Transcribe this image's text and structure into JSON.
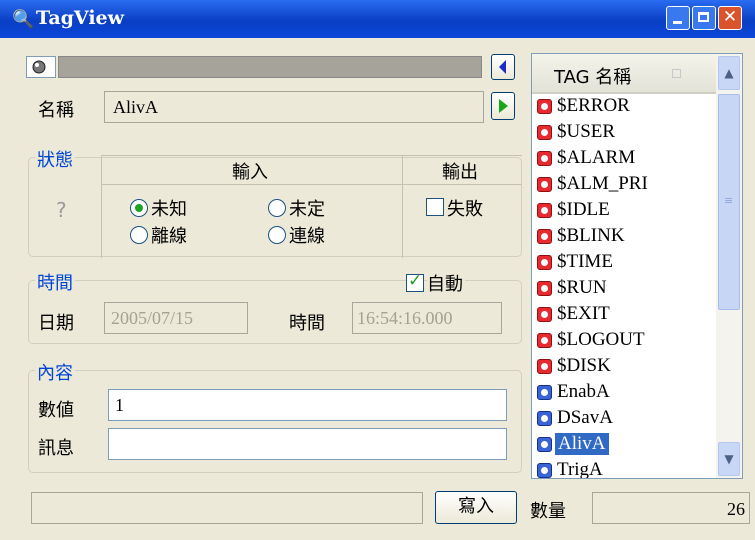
{
  "window": {
    "title": "TagView"
  },
  "top": {
    "name_label": "名稱",
    "name_value": "AlivA"
  },
  "status": {
    "group_label": "狀態",
    "unknown_mark": "?",
    "input_header": "輸入",
    "output_header": "輸出",
    "radios": [
      {
        "label": "未知",
        "selected": true
      },
      {
        "label": "未定",
        "selected": false
      },
      {
        "label": "離線",
        "selected": false
      },
      {
        "label": "連線",
        "selected": false
      }
    ],
    "fail_label": "失敗",
    "fail_checked": false
  },
  "time": {
    "group_label": "時間",
    "auto_label": "自動",
    "auto_checked": true,
    "date_label": "日期",
    "date_value": "2005/07/15",
    "time_label": "時間",
    "time_value": "16:54:16.000"
  },
  "content": {
    "group_label": "內容",
    "value_label": "數値",
    "value": "1",
    "message_label": "訊息",
    "message": ""
  },
  "bottom": {
    "write_button": "寫入",
    "count_label": "數量",
    "count_value": "26"
  },
  "taglist": {
    "header": "TAG 名稱",
    "items": [
      {
        "name": "$ERROR",
        "type": "system"
      },
      {
        "name": "$USER",
        "type": "system"
      },
      {
        "name": "$ALARM",
        "type": "system"
      },
      {
        "name": "$ALM_PRI",
        "type": "system"
      },
      {
        "name": "$IDLE",
        "type": "system"
      },
      {
        "name": "$BLINK",
        "type": "system"
      },
      {
        "name": "$TIME",
        "type": "system"
      },
      {
        "name": "$RUN",
        "type": "system"
      },
      {
        "name": "$EXIT",
        "type": "system"
      },
      {
        "name": "$LOGOUT",
        "type": "system"
      },
      {
        "name": "$DISK",
        "type": "system"
      },
      {
        "name": "EnabA",
        "type": "user"
      },
      {
        "name": "DSavA",
        "type": "user"
      },
      {
        "name": "AlivA",
        "type": "user",
        "selected": true
      },
      {
        "name": "TrigA",
        "type": "user"
      }
    ]
  },
  "colors": {
    "titlebar": "#0a3fc4",
    "group_title": "#0046d5",
    "selection": "#316ac5",
    "system_icon": "#e8292f",
    "user_icon": "#3a63d8"
  }
}
